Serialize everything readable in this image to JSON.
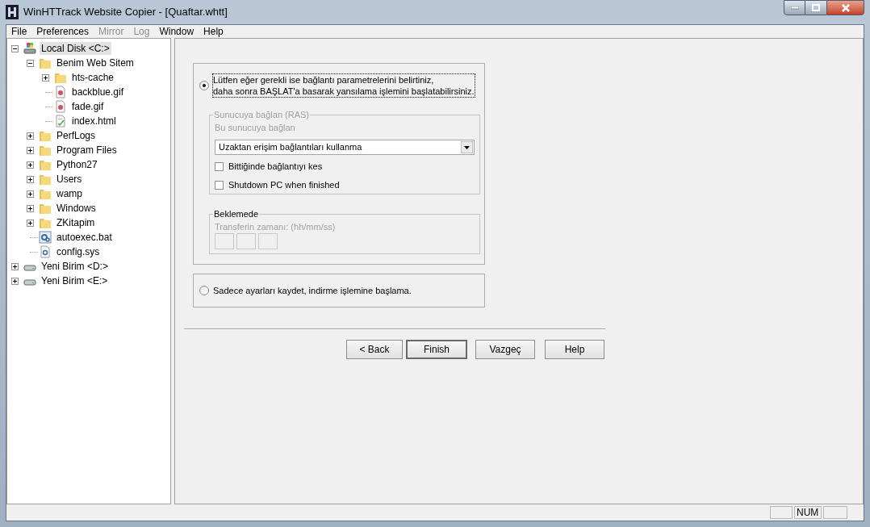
{
  "window": {
    "title": "WinHTTrack Website Copier - [Quaftar.whtt]"
  },
  "menu": [
    {
      "label": "File",
      "disabled": false
    },
    {
      "label": "Preferences",
      "disabled": false
    },
    {
      "label": "Mirror",
      "disabled": true
    },
    {
      "label": "Log",
      "disabled": true
    },
    {
      "label": "Window",
      "disabled": false
    },
    {
      "label": "Help",
      "disabled": false
    }
  ],
  "tree": [
    {
      "label": "Local Disk <C:>",
      "kind": "system-drive",
      "selected": true,
      "expanded": true,
      "children": [
        {
          "label": "Benim Web Sitem",
          "kind": "folder",
          "selected": false,
          "expanded": true,
          "children": [
            {
              "label": "hts-cache",
              "kind": "folder",
              "selected": false,
              "expanded": false
            },
            {
              "label": "backblue.gif",
              "kind": "image",
              "selected": false
            },
            {
              "label": "fade.gif",
              "kind": "image",
              "selected": false
            },
            {
              "label": "index.html",
              "kind": "document",
              "selected": false
            }
          ]
        },
        {
          "label": "PerfLogs",
          "kind": "folder",
          "selected": false,
          "expanded": false
        },
        {
          "label": "Program Files",
          "kind": "folder",
          "selected": false,
          "expanded": false
        },
        {
          "label": "Python27",
          "kind": "folder",
          "selected": false,
          "expanded": false
        },
        {
          "label": "Users",
          "kind": "folder",
          "selected": false,
          "expanded": false
        },
        {
          "label": "wamp",
          "kind": "folder",
          "selected": false,
          "expanded": false
        },
        {
          "label": "Windows",
          "kind": "folder",
          "selected": false,
          "expanded": false
        },
        {
          "label": "ZKitapim",
          "kind": "folder",
          "selected": false,
          "expanded": false
        },
        {
          "label": "autoexec.bat",
          "kind": "batch",
          "selected": false
        },
        {
          "label": "config.sys",
          "kind": "settings",
          "selected": false
        }
      ]
    },
    {
      "label": "Yeni Birim <D:>",
      "kind": "drive",
      "selected": false,
      "expanded": false
    },
    {
      "label": "Yeni Birim <E:>",
      "kind": "drive",
      "selected": false,
      "expanded": false
    }
  ],
  "options": [
    {
      "lines": [
        "Lütfen eğer gerekli ise bağlantı parametrelerini belirtiniz,",
        "daha sonra BAŞLAT'a basarak yansılama işlemini başlatabilirsiniz."
      ],
      "selected": true
    },
    {
      "lines": [
        "Sadece ayarları kaydet, indirme işlemine başlama."
      ],
      "selected": false
    }
  ],
  "ras_group": {
    "legend": "Sunucuya bağlan (RAS)",
    "disabled": true,
    "label": "Bu sunucuya bağlan",
    "dropdown": "Uzaktan erişim bağlantıları kullanma",
    "checkboxes": [
      {
        "label": "Bittiğinde bağlantıyı kes",
        "checked": false
      },
      {
        "label": "Shutdown PC when finished",
        "checked": false
      }
    ]
  },
  "wait_group": {
    "legend": "Beklemede",
    "label": "Transferin zamanı: (hh/mm/ss)",
    "label_disabled": true
  },
  "buttons": [
    {
      "label": "< Back",
      "default": false
    },
    {
      "label": "Finish",
      "default": true
    },
    {
      "label": "Vazgeç",
      "default": false
    },
    {
      "label": "Help",
      "default": false
    }
  ],
  "status_bar": {
    "num": "NUM"
  }
}
